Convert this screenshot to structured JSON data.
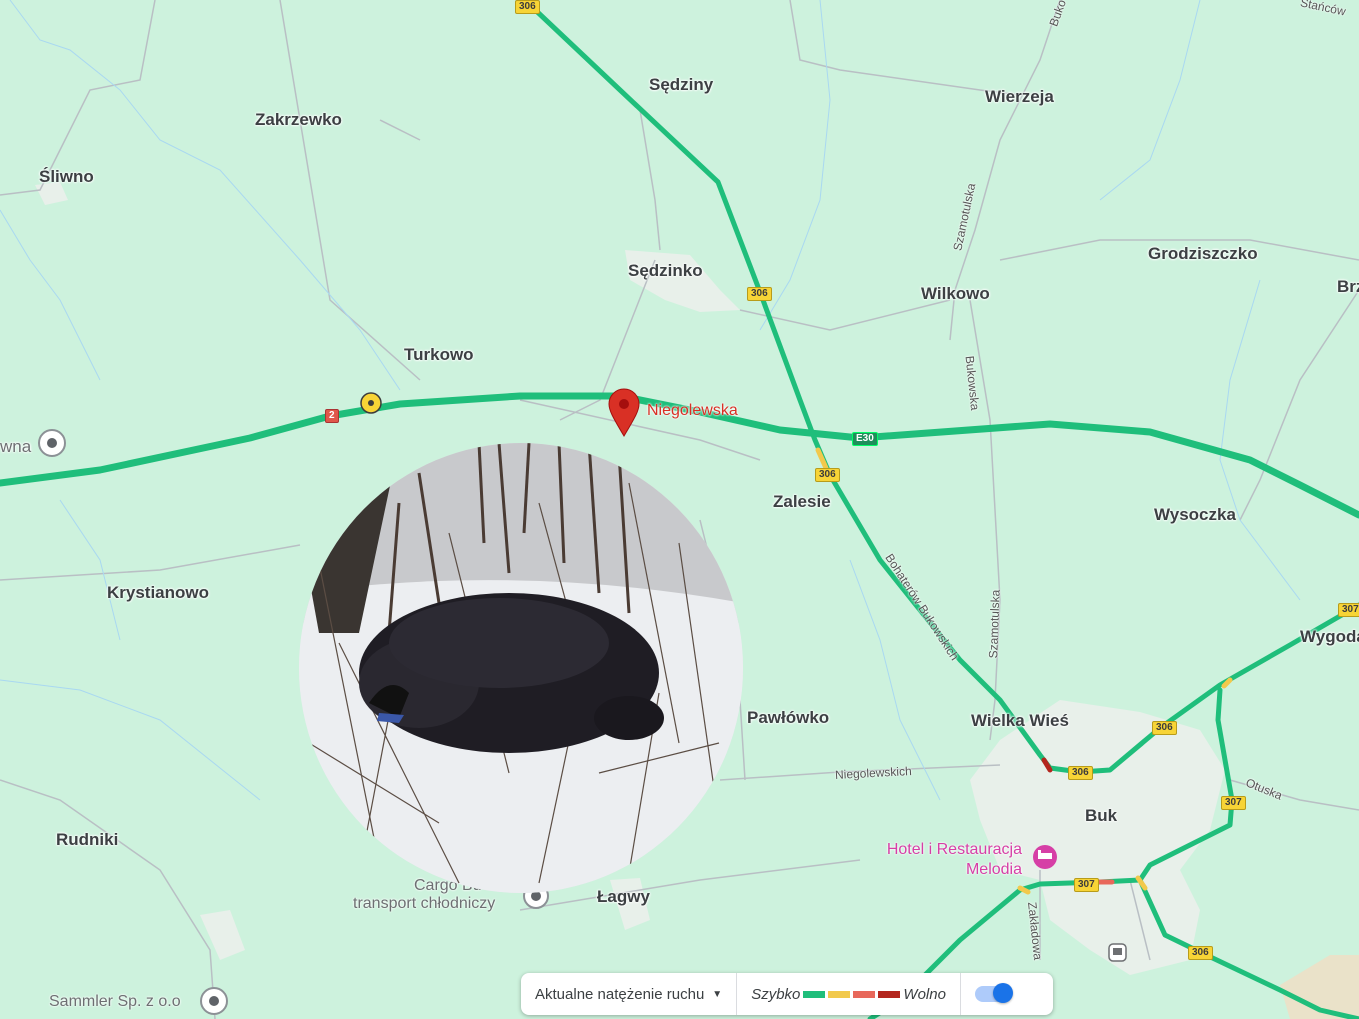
{
  "colors": {
    "map_background": "#cdf2dd",
    "traffic_fast": "#1fbe7b",
    "pin": "#d93025",
    "hotel": "#d63fa6"
  },
  "places": {
    "sliwno": "Śliwno",
    "zakrzewko": "Zakrzewko",
    "sedziny": "Sędziny",
    "wierzeja": "Wierzeja",
    "sedzinko": "Sędzinko",
    "grodziszczko": "Grodziszczko",
    "wilkowo": "Wilkowo",
    "brz": "Brz",
    "turkowo": "Turkowo",
    "wna": "wna",
    "zalesie": "Zalesie",
    "wysoczka": "Wysoczka",
    "krystianowo": "Krystianowo",
    "wygoda": "Wygoda",
    "pawlowko": "Pawłówko",
    "wielka_wies": "Wielka Wieś",
    "buk": "Buk",
    "rudniki": "Rudniki",
    "lagwy": "Łagwy"
  },
  "pin": {
    "label": "Niegolewska",
    "icon": "map-pin-icon"
  },
  "pois": {
    "cargo_line1": "Cargo Bu",
    "cargo_line2": "transport chłodniczy",
    "sammler": "Sammler Sp. z o.o",
    "hotel_line1": "Hotel i Restauracja",
    "hotel_line2": "Melodia"
  },
  "streets": {
    "szamotulska_top": "Szamotulska",
    "bukowska": "Bukowska",
    "bohaterow": "Bohaterów Bukowskich",
    "szamotulska_mid": "Szamotulska",
    "niegolewskich": "Niegolewskich",
    "otuska": "Otuska",
    "zakladowa": "Zakładowa",
    "bukowska_top": "Buko",
    "stanicow": "Stańców"
  },
  "road_badges": {
    "r306_top": "306",
    "r306_mid": "306",
    "r306_zalesie": "306",
    "r306_buk": "306",
    "r306_east": "306",
    "r306_south": "306",
    "r307_east": "307",
    "r307_south": "307",
    "r307_edge": "307",
    "a2": "2",
    "e30": "E30"
  },
  "legend": {
    "traffic_select_label": "Aktualne natężenie ruchu",
    "fast_label": "Szybko",
    "slow_label": "Wolno",
    "speed_colors": [
      "#1fbe7b",
      "#f2c94c",
      "#e8685b",
      "#b3261e"
    ],
    "traffic_toggle": "on"
  }
}
